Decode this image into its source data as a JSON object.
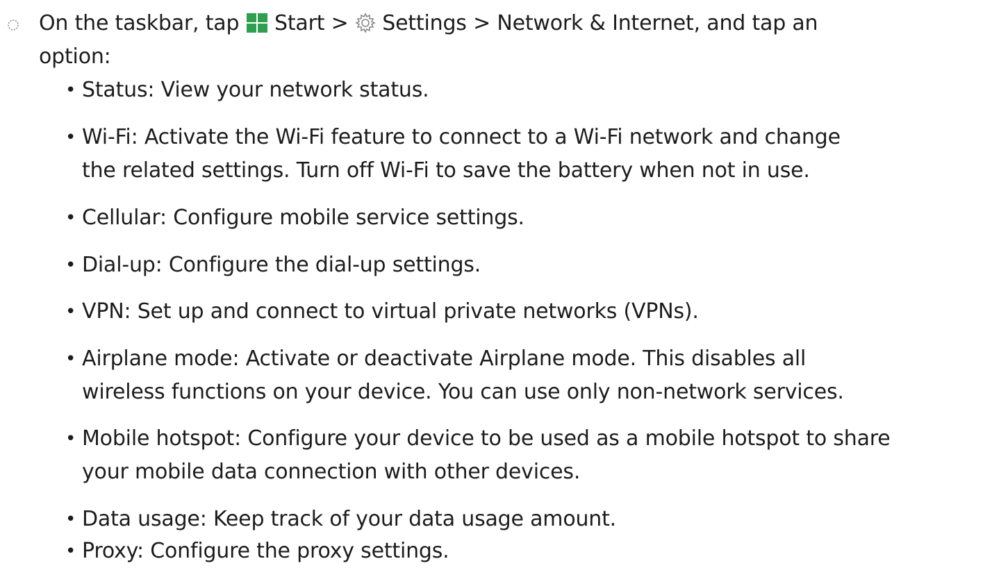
{
  "intro": {
    "prefix": "On the taskbar, tap",
    "start": "Start",
    "sep1": ">",
    "settings": "Settings",
    "sep2": ">",
    "network": "Network & Internet",
    "suffix_line1": ", and tap an",
    "suffix_line2": "option:"
  },
  "icons": {
    "step": "dotted-circle-icon",
    "start": "windows-start-icon",
    "settings": "gear-icon"
  },
  "colors": {
    "start_icon": "#2e9f4f",
    "text": "#1c1c1c",
    "icon_gray": "#8a8a8a"
  },
  "options": [
    {
      "term": "Status",
      "desc_1": ": View your network status.",
      "desc_2": ""
    },
    {
      "term": "Wi-Fi",
      "desc_1": ": Activate the Wi-Fi feature to connect to a Wi-Fi network and change",
      "desc_2": "the related settings. Turn off Wi-Fi to save the battery when not in use."
    },
    {
      "term": "Cellular",
      "desc_1": ": Configure mobile service settings.",
      "desc_2": ""
    },
    {
      "term": "Dial-up",
      "desc_1": ": Configure the dial-up settings.",
      "desc_2": ""
    },
    {
      "term": "VPN",
      "desc_1": ": Set up and connect to virtual private networks (VPNs).",
      "desc_2": ""
    },
    {
      "term": "Airplane mode",
      "desc_1": ": Activate or deactivate Airplane mode. This disables all",
      "desc_2": "wireless functions on your device. You can use only non-network services."
    },
    {
      "term": "Mobile hotspot",
      "desc_1": ": Configure your device to be used as a mobile hotspot to share",
      "desc_2": "your mobile data connection with other devices."
    },
    {
      "term": "Data usage",
      "desc_1": ": Keep track of your data usage amount.",
      "desc_2": ""
    },
    {
      "term": "Proxy",
      "desc_1": ": Configure the proxy settings.",
      "desc_2": ""
    }
  ]
}
